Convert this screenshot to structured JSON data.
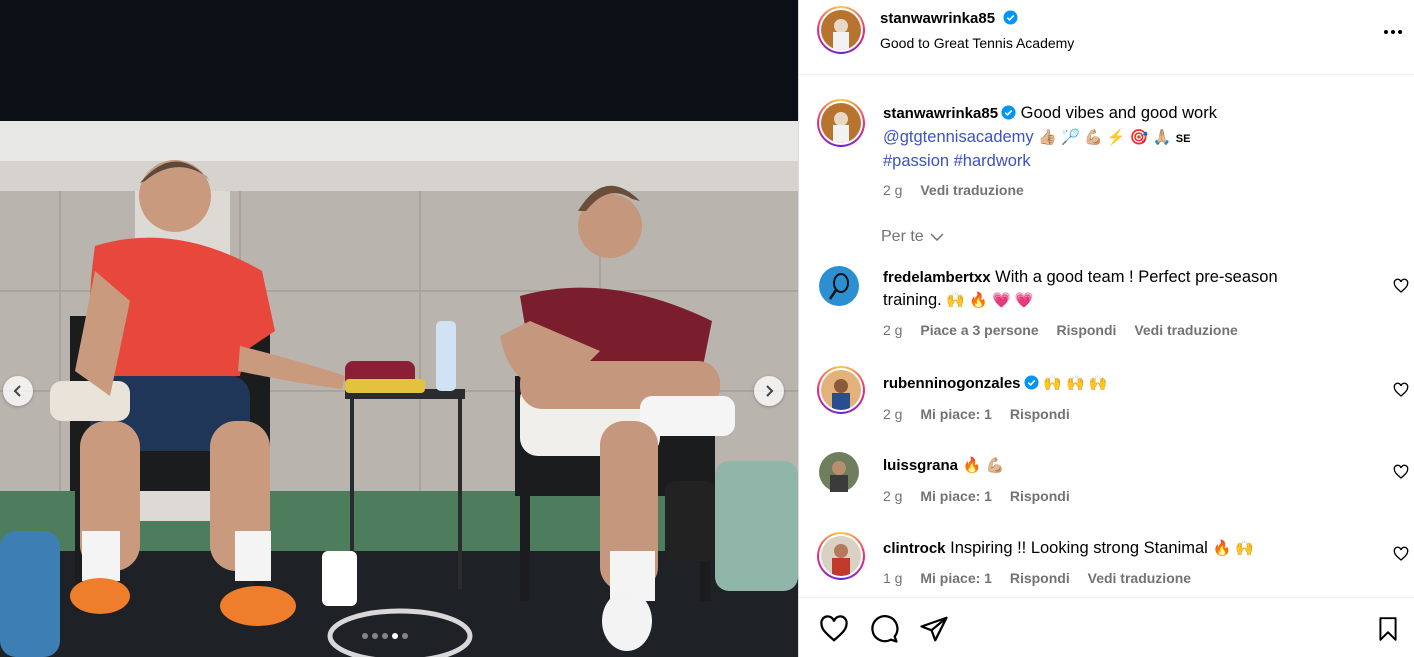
{
  "media": {
    "dots_count": 5,
    "active_dot": 3
  },
  "header": {
    "username": "stanwawrinka85",
    "subtitle": "Good to Great Tennis Academy"
  },
  "caption": {
    "username": "stanwawrinka85",
    "text": "Good vibes and good work",
    "mention": "@gtgtennisacademy",
    "emojis": "👍🏼 🏸 💪🏼 ⚡ 🎯 🙏🏼",
    "se": "SE",
    "hashtags": "#passion #hardwork",
    "time": "2 g",
    "translate": "Vedi traduzione"
  },
  "per_te": "Per te",
  "comments": [
    {
      "username": "fredelambertxx",
      "text": "With a good team ! Perfect pre-season training.",
      "emojis": "🙌 🔥 💗 💗",
      "time": "2 g",
      "likes": "Piace a 3 persone",
      "reply": "Rispondi",
      "translate": "Vedi traduzione"
    },
    {
      "username": "rubenninogonzales",
      "text": "",
      "emojis": "🙌 🙌 🙌",
      "time": "2 g",
      "likes": "Mi piace: 1",
      "reply": "Rispondi"
    },
    {
      "username": "luissgrana",
      "text": "",
      "emojis": "🔥 💪🏼",
      "time": "2 g",
      "likes": "Mi piace: 1",
      "reply": "Rispondi"
    },
    {
      "username": "clintrock",
      "text": "Inspiring !! Looking strong Stanimal",
      "emojis": "🔥 🙌",
      "time": "1 g",
      "likes": "Mi piace: 1",
      "reply": "Rispondi",
      "translate": "Vedi traduzione"
    }
  ],
  "colors": {
    "link": "#3b52c4",
    "muted": "#737373",
    "verified": "#0095f6",
    "shirt_left": "#e8483b",
    "shirt_right": "#7a1e2e"
  }
}
